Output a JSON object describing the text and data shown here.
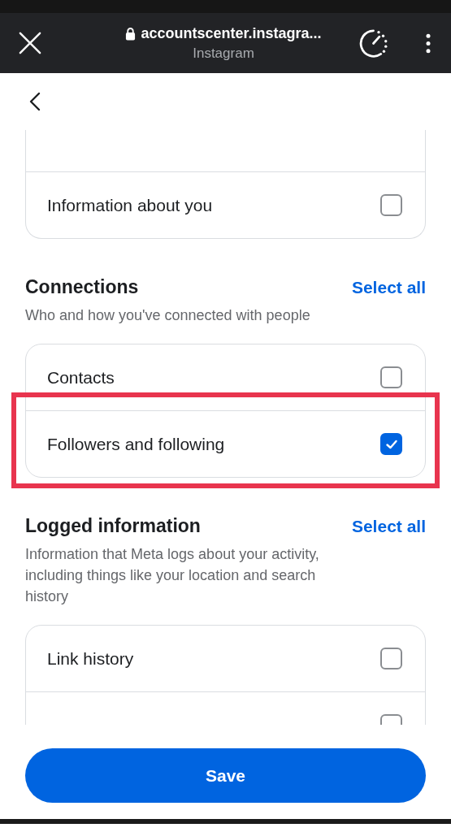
{
  "browser_bar": {
    "url": "accountscenter.instagra...",
    "site": "Instagram"
  },
  "sections": [
    {
      "clipped_above": true,
      "items": [
        {
          "label": "Information about you",
          "checked": false
        }
      ]
    },
    {
      "title": "Connections",
      "action": "Select all",
      "subtitle": "Who and how you've connected with people",
      "items": [
        {
          "label": "Contacts",
          "checked": false
        },
        {
          "label": "Followers and following",
          "checked": true,
          "highlighted": true
        }
      ]
    },
    {
      "title": "Logged information",
      "action": "Select all",
      "subtitle": "Information that Meta logs about your activity, including things like your location and search history",
      "items": [
        {
          "label": "Link history",
          "checked": false
        },
        {
          "checked": false
        }
      ]
    }
  ],
  "save_button": "Save"
}
